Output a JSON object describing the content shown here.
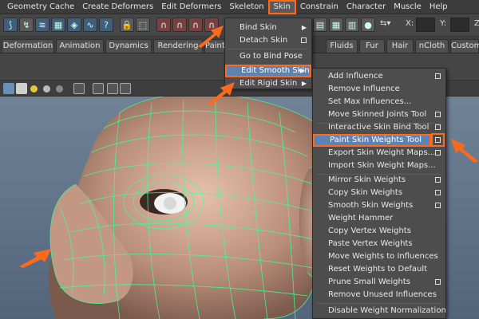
{
  "menubar": {
    "items": [
      "Geometry Cache",
      "Create Deformers",
      "Edit Deformers",
      "Skeleton",
      "Skin",
      "Constrain",
      "Character",
      "Muscle",
      "Help"
    ]
  },
  "status_line": {
    "x_label": "X:",
    "y_label": "Y:",
    "z_label": "Z:"
  },
  "shelf_tabs": [
    "Deformation",
    "Animation",
    "Dynamics",
    "Rendering",
    "Painte",
    "Fluids",
    "Fur",
    "Hair",
    "nCloth",
    "Custom"
  ],
  "skin_menu": {
    "items": [
      {
        "label": "Bind Skin",
        "marker": "submenu"
      },
      {
        "label": "Detach Skin",
        "marker": "option"
      },
      {
        "label": "Go to Bind Pose",
        "marker": ""
      },
      {
        "label": "Edit Smooth Skin",
        "marker": "submenu"
      },
      {
        "label": "Edit Rigid Skin",
        "marker": "submenu"
      }
    ]
  },
  "smooth_skin_menu": {
    "items": [
      {
        "label": "Add Influence",
        "marker": "option"
      },
      {
        "label": "Remove Influence",
        "marker": ""
      },
      {
        "label": "Set Max Influences...",
        "marker": ""
      },
      {
        "label": "Move Skinned Joints Tool",
        "marker": "option"
      },
      {
        "label": "Interactive Skin Bind Tool",
        "marker": "option"
      },
      {
        "label": "Paint Skin Weights Tool",
        "marker": "option"
      },
      {
        "label": "Export Skin Weight Maps...",
        "marker": "option"
      },
      {
        "label": "Import Skin Weight Maps...",
        "marker": ""
      },
      {
        "label": "Mirror Skin Weights",
        "marker": "option"
      },
      {
        "label": "Copy Skin Weights",
        "marker": "option"
      },
      {
        "label": "Smooth Skin Weights",
        "marker": "option"
      },
      {
        "label": "Weight Hammer",
        "marker": ""
      },
      {
        "label": "Copy Vertex Weights",
        "marker": ""
      },
      {
        "label": "Paste Vertex Weights",
        "marker": ""
      },
      {
        "label": "Move Weights to Influences",
        "marker": ""
      },
      {
        "label": "Reset Weights to Default",
        "marker": ""
      },
      {
        "label": "Prune Small Weights",
        "marker": "option"
      },
      {
        "label": "Remove Unused Influences",
        "marker": ""
      },
      {
        "label": "Disable Weight Normalization",
        "marker": ""
      }
    ]
  },
  "colors": {
    "highlight": "#5d82b4",
    "callout": "#ff6a1a",
    "wireframe": "#3dff9a",
    "skin": "#c49a85"
  },
  "icons": {
    "viewport": "head-mesh-wireframe",
    "callouts": "orange-arrow-icon"
  }
}
